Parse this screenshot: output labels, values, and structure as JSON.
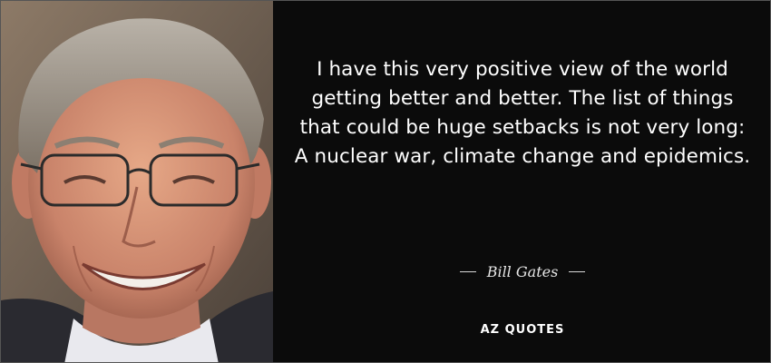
{
  "quote": {
    "text": "I have this very positive view of the world getting better and better. The list of things that could be huge setbacks is not very long: A nuclear war, climate change and epidemics.",
    "author": "Bill Gates"
  },
  "brand": {
    "name": "AZ QUOTES"
  },
  "colors": {
    "background": "#0b0b0b",
    "text": "#ffffff"
  }
}
